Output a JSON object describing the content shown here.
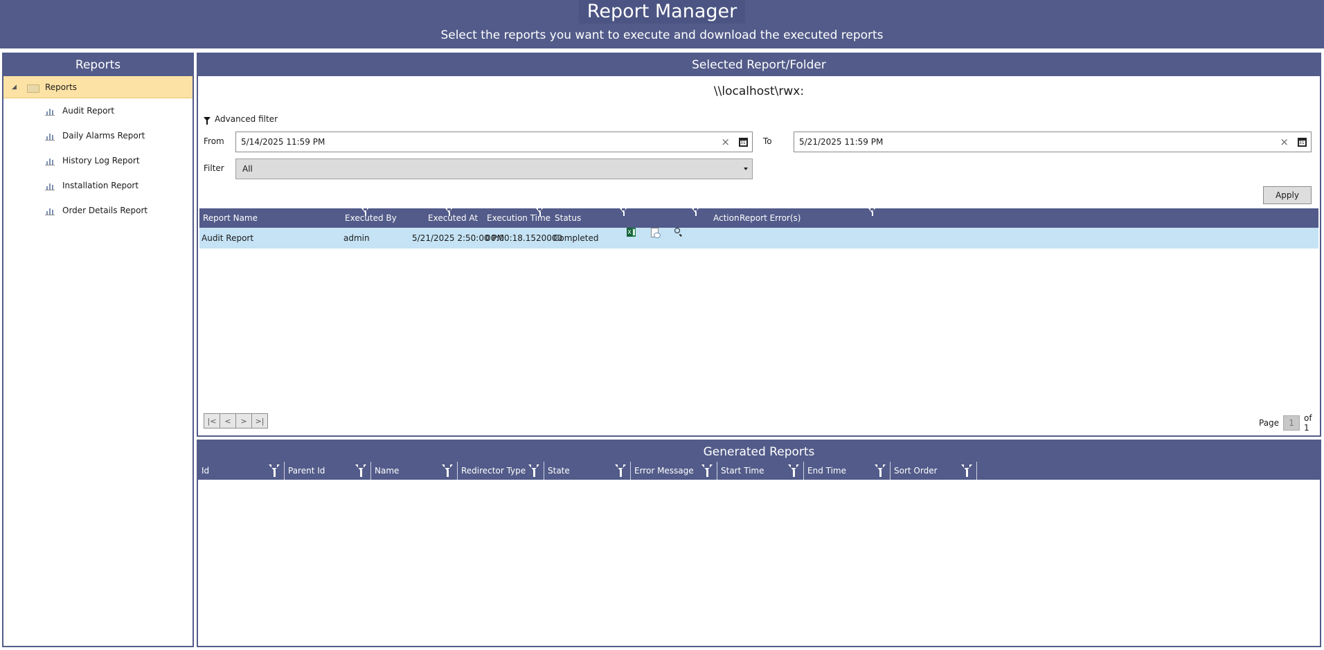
{
  "header": {
    "title": "Report Manager",
    "subtitle": "Select the reports you want to execute and download the executed reports"
  },
  "sidebar": {
    "title": "Reports",
    "root": {
      "label": "Reports",
      "icon": "folder-icon",
      "expanded": true
    },
    "items": [
      {
        "label": "Audit Report",
        "icon": "report-icon"
      },
      {
        "label": "Daily Alarms Report",
        "icon": "report-icon"
      },
      {
        "label": "History Log Report",
        "icon": "report-icon"
      },
      {
        "label": "Installation Report",
        "icon": "report-icon"
      },
      {
        "label": "Order Details Report",
        "icon": "report-icon"
      }
    ]
  },
  "main": {
    "title": "Selected Report/Folder",
    "path": "\\\\localhost\\rwx:",
    "advanced_filter_label": "Advanced filter",
    "from_label": "From",
    "from_value": "5/14/2025 11:59 PM",
    "to_label": "To",
    "to_value": "5/21/2025 11:59 PM",
    "filter_label": "Filter",
    "filter_value": "All",
    "apply_label": "Apply",
    "columns": {
      "report_name": "Report Name",
      "executed_by": "Executed By",
      "executed_at": "Executed At",
      "execution_time": "Execution Time",
      "status": "Status",
      "action": "Action",
      "report_errors": "Report Error(s)"
    },
    "rows": [
      {
        "report_name": "Audit Report",
        "executed_by": "admin",
        "executed_at": "5/21/2025 2:50:00 PM",
        "execution_time": "00:00:18.1520000",
        "status": "Completed"
      }
    ],
    "pager": {
      "page_label": "Page",
      "current_page": "1",
      "of_label": "of 1"
    }
  },
  "generated": {
    "title": "Generated Reports",
    "columns": [
      "Id",
      "Parent Id",
      "Name",
      "Redirector Type",
      "State",
      "Error Message",
      "Start Time",
      "End Time",
      "Sort Order"
    ]
  },
  "colors": {
    "header_bg": "#525b89",
    "selected_tree": "#fde2a5",
    "selected_row": "#c5e3f5"
  }
}
